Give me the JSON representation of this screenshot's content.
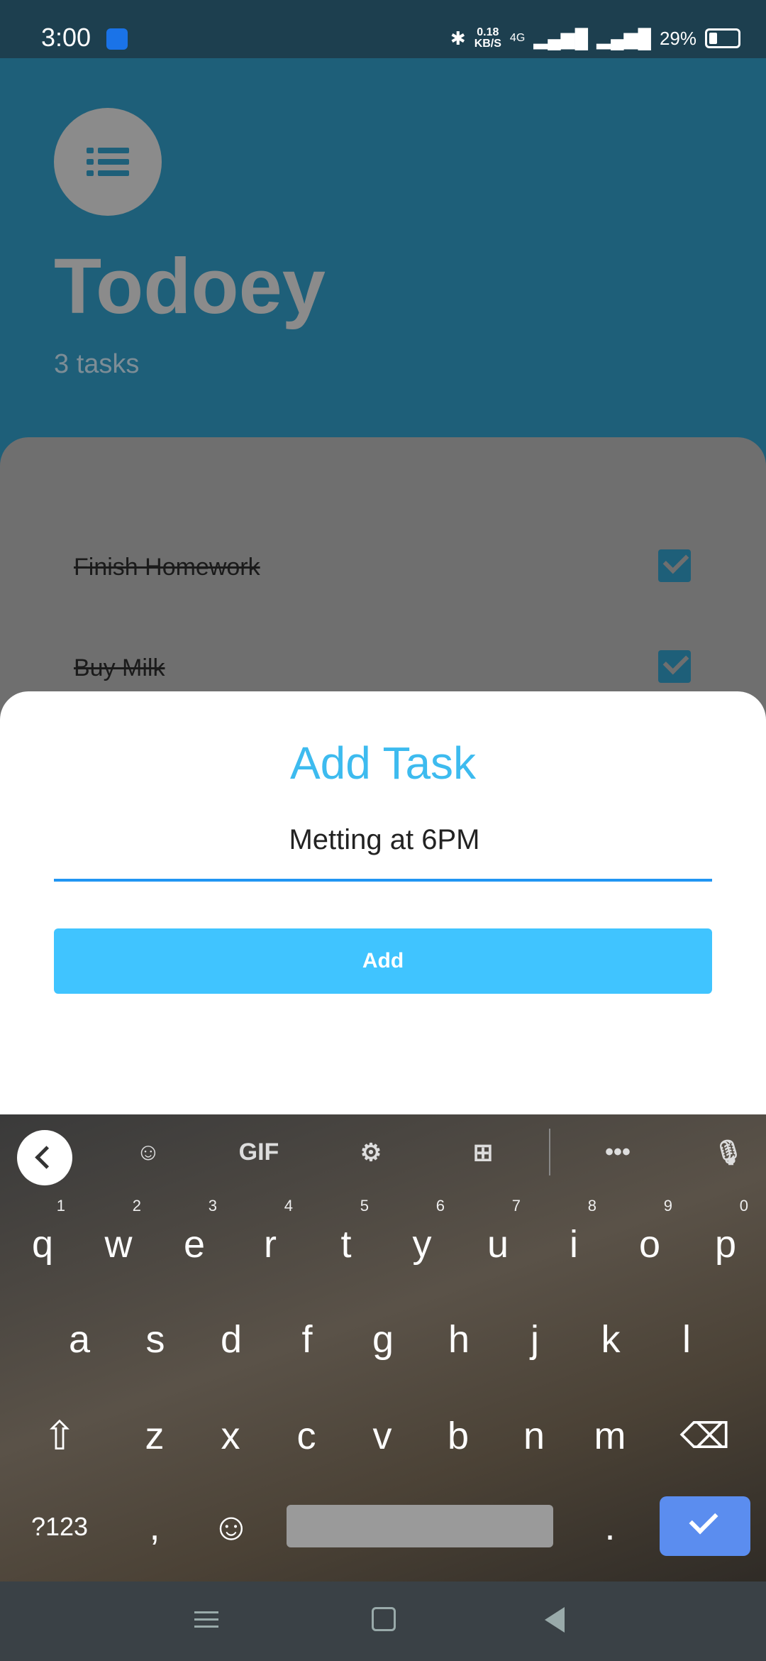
{
  "status_bar": {
    "time": "3:00",
    "net_speed_value": "0.18",
    "net_speed_unit": "KB/S",
    "network": "4G",
    "battery_percent": "29%",
    "battery_level": 0.29
  },
  "app": {
    "title": "Todoey",
    "task_count": "3 tasks",
    "tasks": [
      {
        "label": "Finish Homework",
        "done": true
      },
      {
        "label": "Buy Milk",
        "done": true
      }
    ]
  },
  "sheet": {
    "title": "Add Task",
    "input_value": "Metting at 6PM",
    "button_label": "Add"
  },
  "keyboard": {
    "toolbar": {
      "gif_label": "GIF"
    },
    "row1": [
      {
        "key": "q",
        "hint": "1"
      },
      {
        "key": "w",
        "hint": "2"
      },
      {
        "key": "e",
        "hint": "3"
      },
      {
        "key": "r",
        "hint": "4"
      },
      {
        "key": "t",
        "hint": "5"
      },
      {
        "key": "y",
        "hint": "6"
      },
      {
        "key": "u",
        "hint": "7"
      },
      {
        "key": "i",
        "hint": "8"
      },
      {
        "key": "o",
        "hint": "9"
      },
      {
        "key": "p",
        "hint": "0"
      }
    ],
    "row2": [
      "a",
      "s",
      "d",
      "f",
      "g",
      "h",
      "j",
      "k",
      "l"
    ],
    "row3": [
      "z",
      "x",
      "c",
      "v",
      "b",
      "n",
      "m"
    ],
    "symbols_label": "?123",
    "comma": ",",
    "period": "."
  },
  "colors": {
    "accent": "#40c4ff",
    "title": "#3dbbef",
    "underline": "#2196f3",
    "enter": "#5b8def"
  }
}
